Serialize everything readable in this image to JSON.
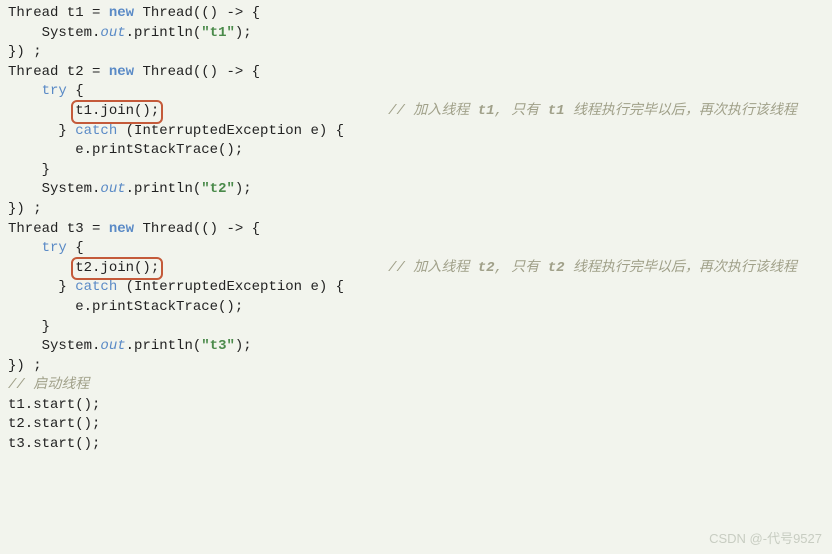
{
  "code": {
    "l1_a": "Thread t1 = ",
    "l1_new": "new",
    "l1_b": " Thread(() -> {",
    "l2_a": "    System.",
    "l2_out": "out",
    "l2_b": ".println(",
    "l2_str": "\"t1\"",
    "l2_c": ");",
    "l3": "}) ;",
    "l4_a": "Thread t2 = ",
    "l4_new": "new",
    "l4_b": " Thread(() -> {",
    "l5_a": "    ",
    "l5_try": "try",
    "l5_b": " {",
    "l6_a": "        ",
    "l6_join": "t1.join();",
    "l6_pad": "                           ",
    "l6_comment_a": "// 加入线程 ",
    "l6_comment_em1": "t1",
    "l6_comment_b": ", 只有 ",
    "l6_comment_em2": "t1",
    "l6_comment_c": " 线程执行完毕以后，再次执行该线程",
    "l7_a": "      } ",
    "l7_catch": "catch",
    "l7_b": " (InterruptedException e) {",
    "l8": "        e.printStackTrace();",
    "l9": "    }",
    "l10_a": "    System.",
    "l10_out": "out",
    "l10_b": ".println(",
    "l10_str": "\"t2\"",
    "l10_c": ");",
    "l11": "}) ;",
    "l12_a": "Thread t3 = ",
    "l12_new": "new",
    "l12_b": " Thread(() -> {",
    "l13_a": "    ",
    "l13_try": "try",
    "l13_b": " {",
    "l14_a": "        ",
    "l14_join": "t2.join();",
    "l14_pad": "                           ",
    "l14_comment_a": "// 加入线程 ",
    "l14_comment_em1": "t2",
    "l14_comment_b": ", 只有 ",
    "l14_comment_em2": "t2",
    "l14_comment_c": " 线程执行完毕以后，再次执行该线程",
    "l15_a": "      } ",
    "l15_catch": "catch",
    "l15_b": " (InterruptedException e) {",
    "l16": "        e.printStackTrace();",
    "l17": "    }",
    "l18_a": "    System.",
    "l18_out": "out",
    "l18_b": ".println(",
    "l18_str": "\"t3\"",
    "l18_c": ");",
    "l19": "}) ;",
    "l20": "// 启动线程",
    "l21": "t1.start();",
    "l22": "t2.start();",
    "l23": "t3.start();"
  },
  "watermark": "CSDN @-代号9527"
}
